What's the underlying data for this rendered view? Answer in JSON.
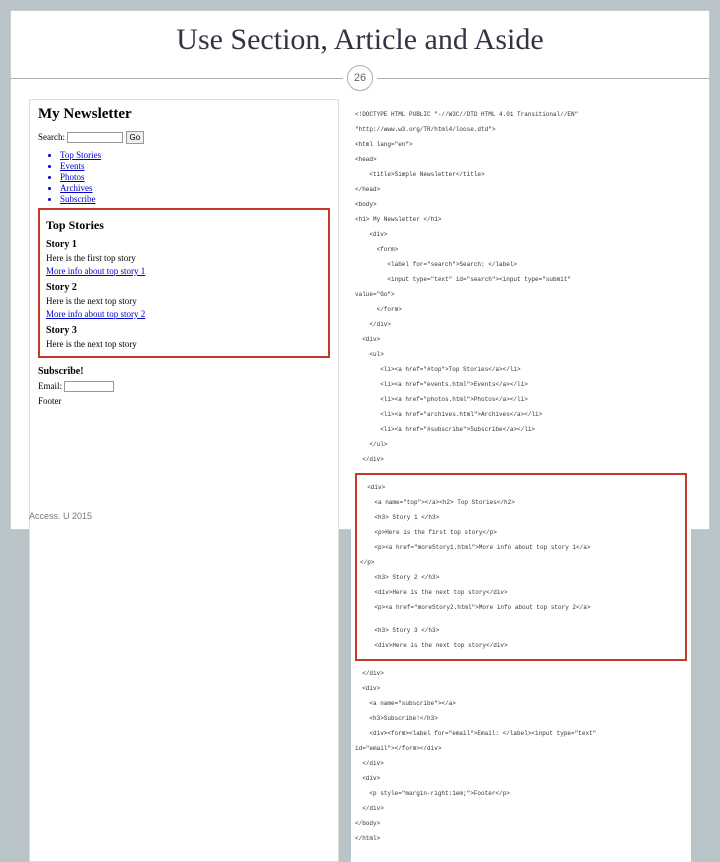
{
  "slide": {
    "title": "Use Section, Article and Aside",
    "pageNumber": "26",
    "footerText": "Access. U 2015"
  },
  "preview": {
    "heading": "My Newsletter",
    "searchLabel": "Search:",
    "goButton": "Go",
    "navItems": [
      "Top Stories",
      "Events",
      "Photos",
      "Archives",
      "Subscribe"
    ],
    "topStoriesHead": "Top Stories",
    "story1Head": "Story 1",
    "story1Text": "Here is the first top story",
    "story1Link": "More info about top story 1",
    "story2Head": "Story 2",
    "story2Text": "Here is the next top story",
    "story2Link": "More info about top story 2",
    "story3Head": "Story 3",
    "story3Text": "Here is the next top story",
    "subscribeHead": "Subscribe!",
    "emailLabel": "Email:",
    "footer": "Footer"
  },
  "code": {
    "l1": "<!DOCTYPE HTML PUBLIC \"-//W3C//DTD HTML 4.01 Transitional//EN\"",
    "l2": "\"http://www.w3.org/TR/html4/loose.dtd\">",
    "l3": "<html lang=\"en\">",
    "l4": "<head>",
    "l5": "    <title>Simple Newsletter</title>",
    "l6": "</head>",
    "l7": "<body>",
    "l8": "<h1> My Newsletter </h1>",
    "l9": "    <div>",
    "l10": "      <form>",
    "l11": "         <label for=\"search\">Search: </label>",
    "l12": "         <input type=\"text\" id=\"search\"><input type=\"submit\"",
    "l13": "value=\"Go\">",
    "l14": "      </form>",
    "l15": "    </div>",
    "l16": "  <div>",
    "l17": "    <ul>",
    "l18": "       <li><a href=\"#top\">Top Stories</a></li>",
    "l19": "       <li><a href=\"events.html\">Events</a></li>",
    "l20": "       <li><a href=\"photos.html\">Photos</a></li>",
    "l21": "       <li><a href=\"archives.html\">Archives</a></li>",
    "l22": "       <li><a href=\"#subscribe\">Subscribe</a></li>",
    "l23": "    </ul>",
    "l24": "  </div>",
    "r1": "  <div>",
    "r2": "    <a name=\"top\"></a><h2> Top Stories</h2>",
    "r3": "    <h3> Story 1 </h3>",
    "r4": "    <p>Here is the first top story</p>",
    "r5": "    <p><a href=\"moreStory1.html\">More info about top story 1</a>",
    "r6": "</p>",
    "r7": "    <h3> Story 2 </h3>",
    "r8": "    <div>Here is the next top story</div>",
    "r9": "    <p><a href=\"moreStory2.html\">More info about top story 2</a>",
    "r10": "",
    "r11": "    <h3> Story 3 </h3>",
    "r12": "    <div>Here is the next top story</div>",
    "l25": "  </div>",
    "l26": "  <div>",
    "l27": "    <a name=\"subscribe\"></a>",
    "l28": "    <h3>Subscribe!</h3>",
    "l29": "    <div><form><label for=\"email\">Email: </label><input type=\"text\"",
    "l30": "id=\"email\"></form></div>",
    "l31": "  </div>",
    "l32": "  <div>",
    "l33": "    <p style=\"margin-right:1em;\">Footer</p>",
    "l34": "  </div>",
    "l35": "</body>",
    "l36": "</html>"
  }
}
